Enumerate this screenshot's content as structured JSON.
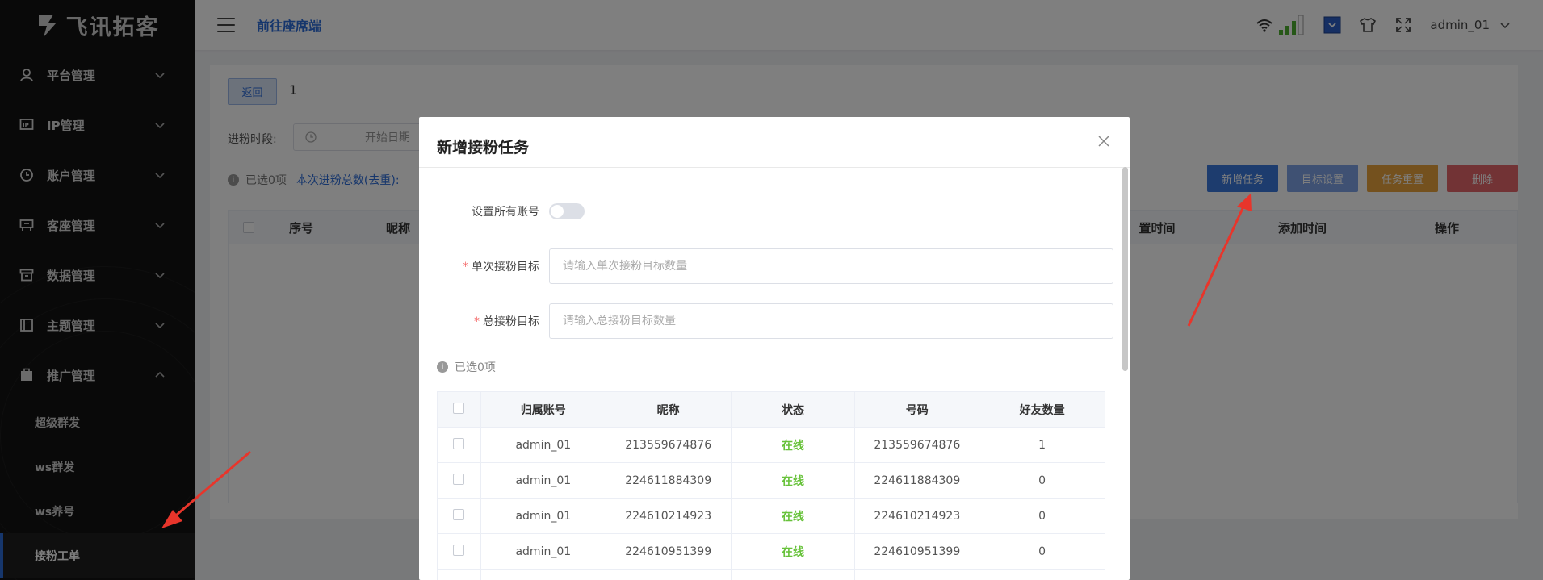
{
  "sidebar": {
    "logo": "飞讯拓客",
    "menu": [
      {
        "label": "平台管理",
        "icon": "user-icon"
      },
      {
        "label": "IP管理",
        "icon": "ip-icon"
      },
      {
        "label": "账户管理",
        "icon": "account-icon"
      },
      {
        "label": "客座管理",
        "icon": "seat-icon"
      },
      {
        "label": "数据管理",
        "icon": "archive-icon"
      },
      {
        "label": "主题管理",
        "icon": "theme-icon"
      },
      {
        "label": "推广管理",
        "icon": "promo-icon"
      }
    ],
    "submenu": [
      "超级群发",
      "ws群发",
      "ws养号",
      "接粉工单"
    ]
  },
  "header": {
    "goto": "前往座席端",
    "user": "admin_01"
  },
  "main": {
    "back_label": "返回",
    "back_num": "1",
    "period_label": "进粉时段:",
    "date_placeholder": "开始日期",
    "selected": "已选0项",
    "total_label": "本次进粉总数(去重):",
    "buttons": {
      "add": "新增任务",
      "target": "目标设置",
      "reset": "任务重置",
      "delete": "删除"
    },
    "columns": {
      "index": "序号",
      "nickname": "昵称",
      "set_time": "置时间",
      "add_time": "添加时间",
      "ops": "操作"
    }
  },
  "modal": {
    "title": "新增接粉任务",
    "set_all_label": "设置所有账号",
    "single_target_label": "单次接粉目标",
    "single_target_placeholder": "请输入单次接粉目标数量",
    "total_target_label": "总接粉目标",
    "total_target_placeholder": "请输入总接粉目标数量",
    "selected": "已选0项",
    "columns": {
      "owner": "归属账号",
      "nickname": "昵称",
      "status": "状态",
      "number": "号码",
      "friends": "好友数量"
    },
    "rows": [
      {
        "owner": "admin_01",
        "nickname": "213559674876",
        "status": "在线",
        "number": "213559674876",
        "friends": "1"
      },
      {
        "owner": "admin_01",
        "nickname": "224611884309",
        "status": "在线",
        "number": "224611884309",
        "friends": "0"
      },
      {
        "owner": "admin_01",
        "nickname": "224610214923",
        "status": "在线",
        "number": "224610214923",
        "friends": "0"
      },
      {
        "owner": "admin_01",
        "nickname": "224610951399",
        "status": "在线",
        "number": "224610951399",
        "friends": "0"
      }
    ]
  },
  "colors": {
    "accent": "#2d6cd8",
    "online": "#67c23a",
    "annotation_arrow": "#e8352b"
  }
}
